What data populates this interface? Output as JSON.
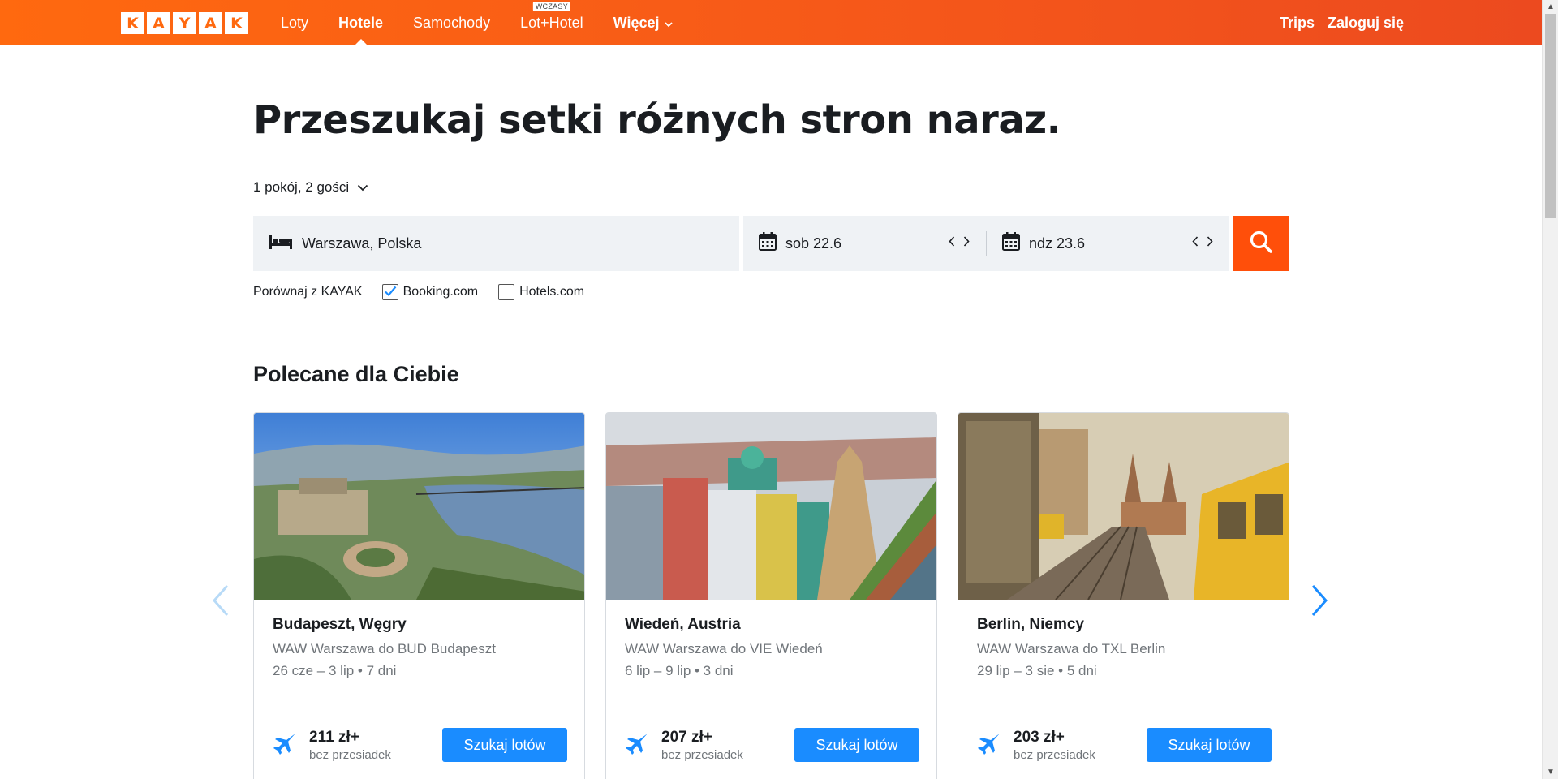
{
  "header": {
    "logo_letters": [
      "K",
      "A",
      "Y",
      "A",
      "K"
    ],
    "nav": [
      {
        "label": "Loty"
      },
      {
        "label": "Hotele"
      },
      {
        "label": "Samochody"
      },
      {
        "label": "Lot+Hotel",
        "badge": "WCZASY"
      },
      {
        "label": "Więcej"
      }
    ],
    "trips_label": "Trips",
    "login_label": "Zaloguj się"
  },
  "hero": {
    "headline": "Przeszukaj setki różnych stron naraz.",
    "rooms_label": "1 pokój, 2 gości"
  },
  "search": {
    "destination": "Warszawa, Polska",
    "checkin": "sob 22.6",
    "checkout": "ndz 23.6"
  },
  "compare": {
    "label": "Porównaj z KAYAK",
    "options": [
      {
        "label": "Booking.com",
        "checked": true
      },
      {
        "label": "Hotels.com",
        "checked": false
      }
    ]
  },
  "recommended": {
    "title": "Polecane dla Ciebie",
    "cards": [
      {
        "title": "Budapeszt, Węgry",
        "route": "WAW Warszawa do BUD Budapeszt",
        "dates": "26 cze – 3 lip • 7 dni",
        "price": "211 zł+",
        "price_note": "bez przesiadek",
        "button": "Szukaj lotów"
      },
      {
        "title": "Wiedeń, Austria",
        "route": "WAW Warszawa do VIE Wiedeń",
        "dates": "6 lip – 9 lip • 3 dni",
        "price": "207 zł+",
        "price_note": "bez przesiadek",
        "button": "Szukaj lotów"
      },
      {
        "title": "Berlin, Niemcy",
        "route": "WAW Warszawa do TXL Berlin",
        "dates": "29 lip – 3 sie • 5 dni",
        "price": "203 zł+",
        "price_note": "bez przesiadek",
        "button": "Szukaj lotów"
      }
    ]
  },
  "colors": {
    "brand": "#ff690f",
    "search_button": "#ff4f0a",
    "card_button": "#1a8cff",
    "arrow_active": "#1a8cff",
    "arrow_inactive": "#b7daf7"
  }
}
